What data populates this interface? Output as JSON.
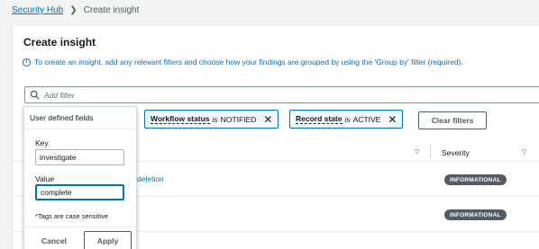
{
  "breadcrumb": {
    "root": "Security Hub",
    "current": "Create insight"
  },
  "page": {
    "title": "Create insight",
    "info_text": "To create an insight, add any relevant filters and choose how your findings are grouped by using the 'Group by' filter (required)."
  },
  "search": {
    "placeholder": "Add filter"
  },
  "filters": [
    {
      "label": "Workflow status",
      "operator": "is",
      "value": "NOTIFIED"
    },
    {
      "label": "Record state",
      "operator": "is",
      "value": "ACTIVE"
    }
  ],
  "clear_filters_label": "Clear filters",
  "table": {
    "severity_header": "Severity",
    "rows": [
      {
        "link_text": "deletion",
        "severity": "INFORMATIONAL"
      },
      {
        "link_text": "",
        "severity": "INFORMATIONAL"
      }
    ]
  },
  "popover": {
    "title": "User defined fields",
    "key_label": "Key",
    "key_value": "investigate",
    "value_label": "Value",
    "value_value": "complete",
    "note": "*Tags are case sensitive",
    "cancel_label": "Cancel",
    "apply_label": "Apply"
  },
  "colors": {
    "link": "#0073bb",
    "badge": "#545b64",
    "chip_border": "#0073bb"
  }
}
